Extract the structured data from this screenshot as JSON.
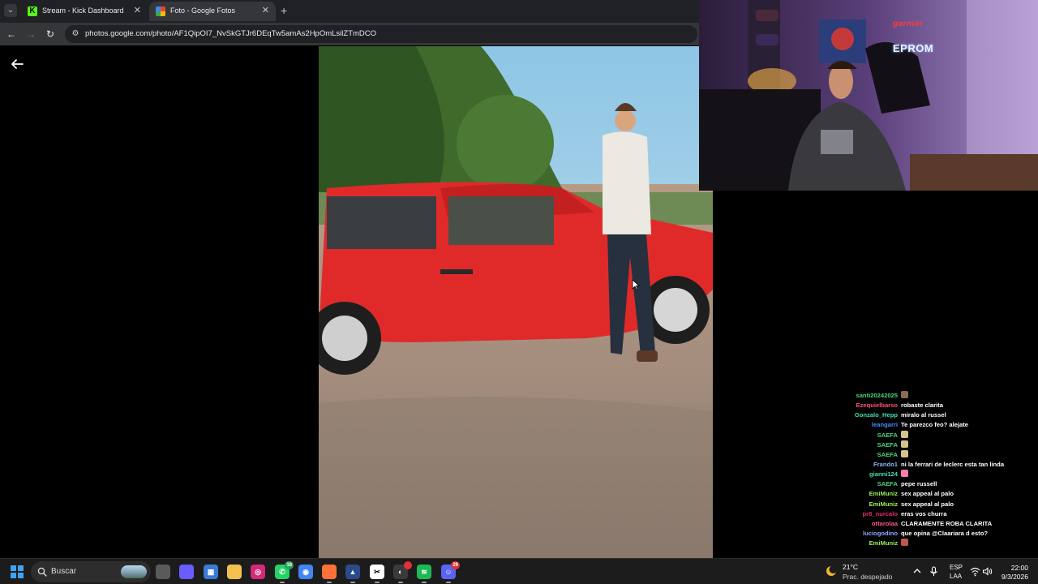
{
  "browser": {
    "tabs": [
      {
        "title": "Stream - Kick Dashboard",
        "icon": "kick-icon",
        "active": false
      },
      {
        "title": "Foto - Google Fotos",
        "icon": "google-photos-icon",
        "active": true
      }
    ],
    "url": "photos.google.com/photo/AF1QipOI7_NvSkGTJr6DEqTw5amAs2HpOmLsilZTmDCO"
  },
  "webcam": {
    "logo_top": "garnier",
    "logo_bottom": "EPROM"
  },
  "chat": {
    "messages": [
      {
        "user": "santi20242025",
        "color": "#4fd17a",
        "text": "",
        "emote": "#8a6b4f"
      },
      {
        "user": "Ezequielbarso",
        "color": "#ff4f7a",
        "text": "robaste clarita"
      },
      {
        "user": "Gonzalo_Hepp",
        "color": "#3fe0b0",
        "text": "miralo al russel"
      },
      {
        "user": "leangarri",
        "color": "#4a8cff",
        "text": "Te parezco feo? alejate"
      },
      {
        "user": "SAEFA",
        "color": "#4fd17a",
        "text": "",
        "emote": "#d6c28a"
      },
      {
        "user": "SAEFA",
        "color": "#4fd17a",
        "text": "",
        "emote": "#d6c28a"
      },
      {
        "user": "SAEFA",
        "color": "#4fd17a",
        "text": "",
        "emote": "#d6c28a"
      },
      {
        "user": "Frando1",
        "color": "#8ab4ff",
        "text": "ni la ferrari de leclerc esta tan linda"
      },
      {
        "user": "gianni124",
        "color": "#3fe0b0",
        "text": "",
        "emote": "#ff7ab0"
      },
      {
        "user": "SAEFA",
        "color": "#4fd17a",
        "text": "pepe russell"
      },
      {
        "user": "EmiMuniz",
        "color": "#9af25a",
        "text": "sex appeal al palo"
      },
      {
        "user": "EmiMuniz",
        "color": "#9af25a",
        "text": "sex appeal al palo"
      },
      {
        "user": "pr8_nurcalo",
        "color": "#e0306a",
        "text": "eras vos churra"
      },
      {
        "user": "ottarolaa",
        "color": "#ff5a8a",
        "text": "CLARAMENTE ROBA CLARITA"
      },
      {
        "user": "luciogodino",
        "color": "#8fa8ff",
        "text": "que opina @Claariara d esto?"
      },
      {
        "user": "EmiMuniz",
        "color": "#9af25a",
        "text": "",
        "emote": "#c0584a"
      }
    ]
  },
  "taskbar": {
    "search_label": "Buscar",
    "apps": [
      {
        "name": "task-view-icon",
        "color": "#5a5a5a",
        "glyph": ""
      },
      {
        "name": "copilot-icon",
        "color": "#6a5cff",
        "glyph": ""
      },
      {
        "name": "store-icon",
        "color": "#3a7bd5",
        "glyph": "▦"
      },
      {
        "name": "file-explorer-icon",
        "color": "#f2c14e",
        "glyph": ""
      },
      {
        "name": "instagram-icon",
        "color": "#d62976",
        "glyph": "◎"
      },
      {
        "name": "whatsapp-icon",
        "color": "#25d366",
        "glyph": "✆",
        "badge": "18",
        "badge_color": "#25a05a"
      },
      {
        "name": "chrome-icon",
        "color": "#4285f4",
        "glyph": "◉"
      },
      {
        "name": "firefox-icon",
        "color": "#ff7139",
        "glyph": ""
      },
      {
        "name": "vpn-icon",
        "color": "#2b4a8a",
        "glyph": "▲"
      },
      {
        "name": "capcut-icon",
        "color": "#ffffff",
        "glyph": "✂"
      },
      {
        "name": "obs-icon",
        "color": "#3a3a3a",
        "glyph": "◐",
        "badge": "",
        "badge_color": "#e0303a"
      },
      {
        "name": "spotify-icon",
        "color": "#1db954",
        "glyph": "≋"
      },
      {
        "name": "discord-icon",
        "color": "#5865f2",
        "glyph": "☺",
        "badge": "29",
        "badge_color": "#e0303a"
      }
    ],
    "weather_temp": "21°C",
    "weather_desc": "Prac. despejado",
    "lang_top": "ESP",
    "lang_bottom": "LAA",
    "time": "22:00",
    "date": "9/3/2026"
  }
}
